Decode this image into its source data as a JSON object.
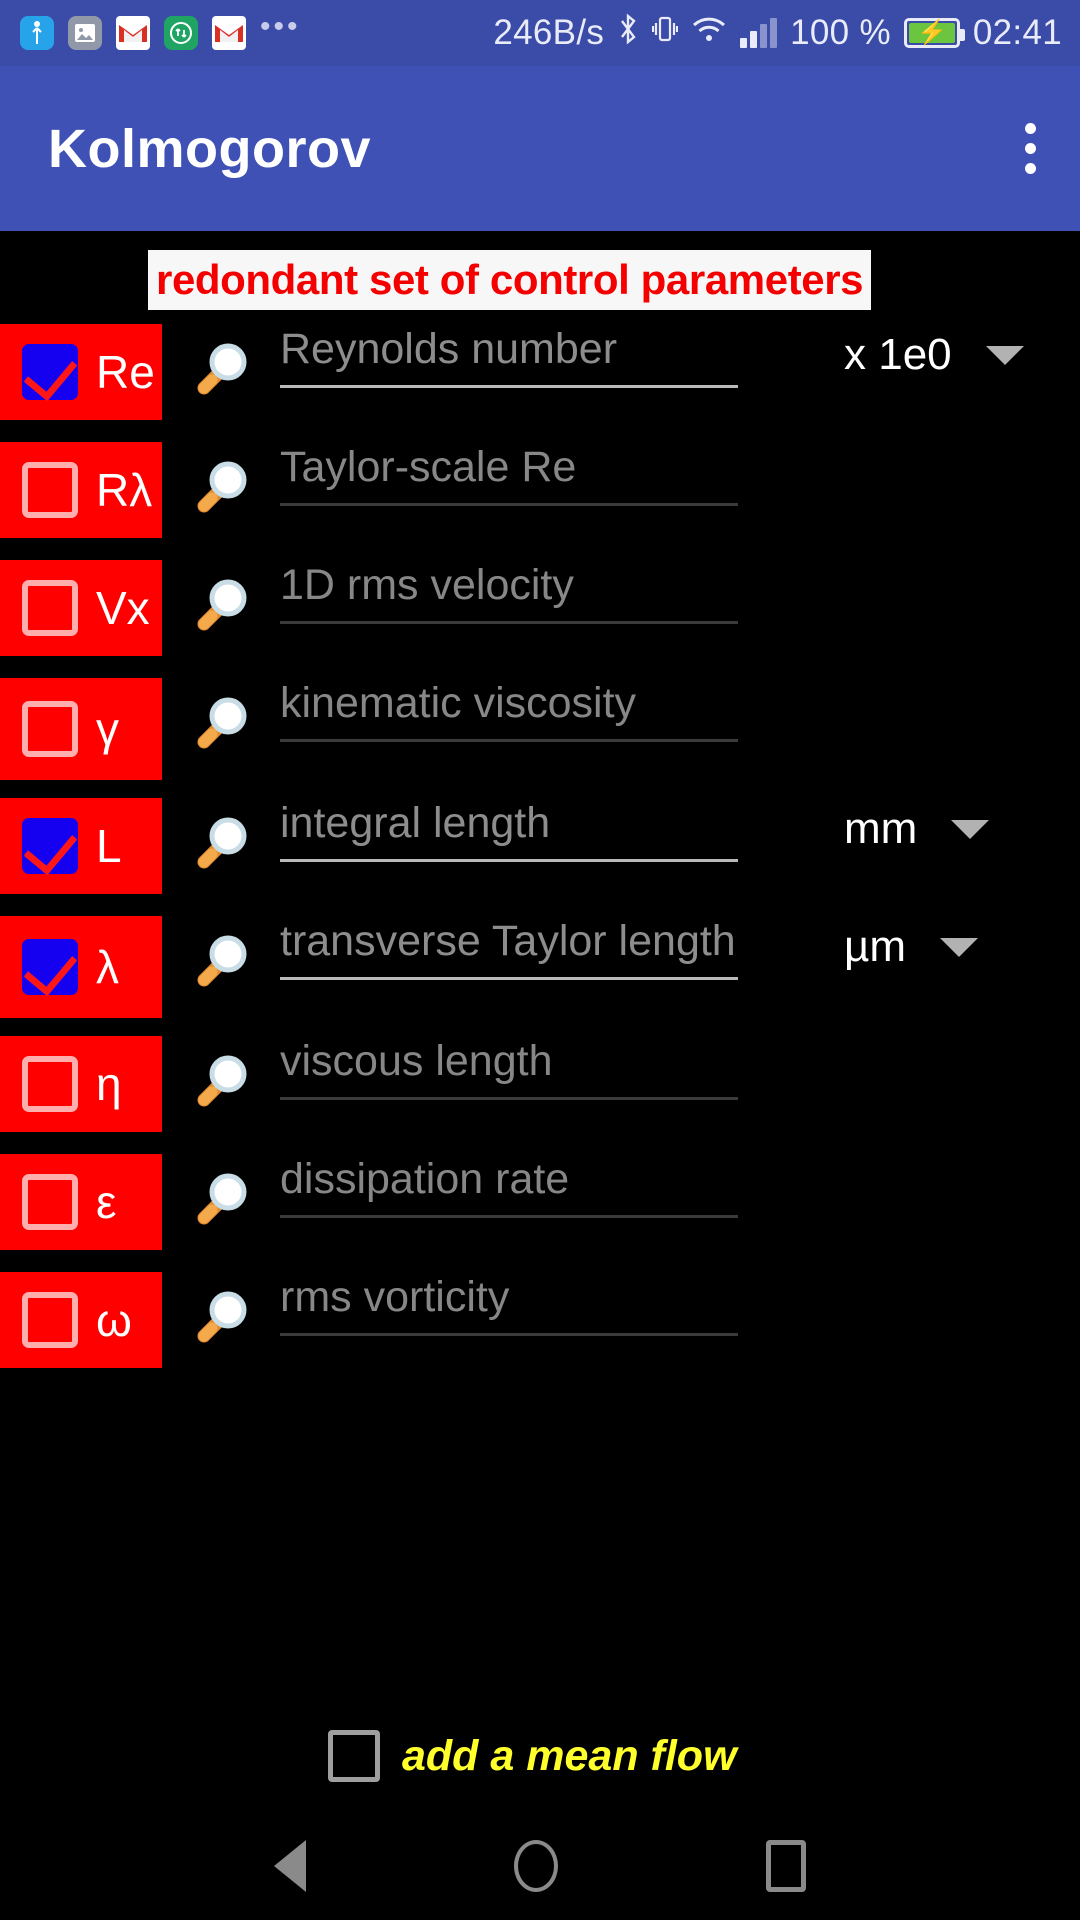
{
  "statusbar": {
    "icons": [
      "usb-icon",
      "gallery-icon",
      "gmail-icon",
      "sync-icon",
      "gmail-icon",
      "more-icon"
    ],
    "network_speed": "246B/s",
    "bluetooth": "bluetooth-icon",
    "vibrate": "vibrate-icon",
    "wifi": "wifi-icon",
    "signal": "signal-icon",
    "battery_percent": "100 %",
    "battery_state": "charging",
    "time": "02:41"
  },
  "appbar": {
    "title": "Kolmogorov",
    "overflow_label": "more-options"
  },
  "banner": {
    "text": "redondant set of control parameters",
    "text_color": "#f40000",
    "background": "#f7f7f7"
  },
  "colors": {
    "accent_red": "#ff0000",
    "checkbox_checked_fill": "#1500f0",
    "checkbox_check_mark": "#ff1717",
    "checkbox_unchecked_border": "#ffadad",
    "appbar": "#3f51b5",
    "statusbar": "#3b4ba8",
    "mean_flow_text": "#ffff2b"
  },
  "rows": [
    {
      "symbol": "Re",
      "checked": true,
      "placeholder": "Reynolds number",
      "unit": "x 1e0",
      "has_unit": true,
      "active": true
    },
    {
      "symbol": "Rλ",
      "checked": false,
      "placeholder": "Taylor-scale Re",
      "unit": "",
      "has_unit": false,
      "active": false
    },
    {
      "symbol": "Vx",
      "checked": false,
      "placeholder": "1D rms velocity",
      "unit": "",
      "has_unit": false,
      "active": false
    },
    {
      "symbol": "γ",
      "checked": false,
      "placeholder": "kinematic viscosity",
      "unit": "",
      "has_unit": false,
      "active": false
    },
    {
      "symbol": "L",
      "checked": true,
      "placeholder": "integral length",
      "unit": "mm",
      "has_unit": true,
      "active": true
    },
    {
      "symbol": "λ",
      "checked": true,
      "placeholder": "transverse Taylor length",
      "unit": "µm",
      "has_unit": true,
      "active": true
    },
    {
      "symbol": "η",
      "checked": false,
      "placeholder": "viscous length",
      "unit": "",
      "has_unit": false,
      "active": false
    },
    {
      "symbol": "ε",
      "checked": false,
      "placeholder": "dissipation rate",
      "unit": "",
      "has_unit": false,
      "active": false
    },
    {
      "symbol": "ω",
      "checked": false,
      "placeholder": "rms vorticity",
      "unit": "",
      "has_unit": false,
      "active": false
    }
  ],
  "mean_flow": {
    "label": "add a mean flow",
    "checked": false
  },
  "navbar": {
    "back": "back-button",
    "home": "home-button",
    "recents": "recents-button"
  }
}
